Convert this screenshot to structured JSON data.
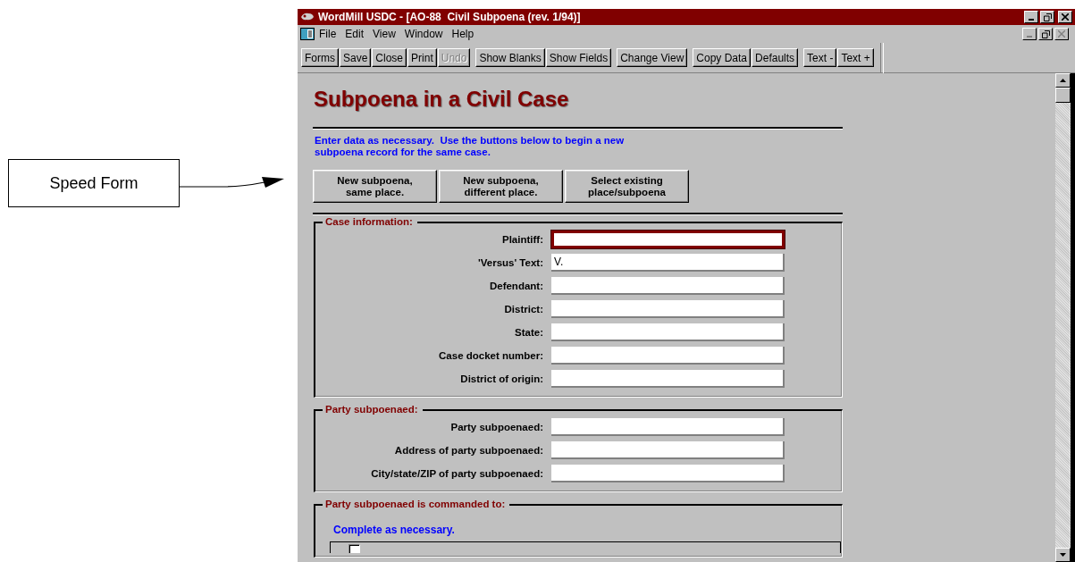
{
  "callout": {
    "label": "Speed Form"
  },
  "window": {
    "title": "WordMill USDC - [AO-88  Civil Subpoena (rev. 1/94)]"
  },
  "menu": [
    "File",
    "Edit",
    "View",
    "Window",
    "Help"
  ],
  "toolbar_groups": [
    [
      {
        "label": "Forms",
        "disabled": false
      },
      {
        "label": "Save",
        "disabled": false
      },
      {
        "label": "Close",
        "disabled": false
      },
      {
        "label": "Print",
        "disabled": false
      },
      {
        "label": "Undo",
        "disabled": true
      }
    ],
    [
      {
        "label": "Show Blanks",
        "disabled": false
      },
      {
        "label": "Show Fields",
        "disabled": false
      }
    ],
    [
      {
        "label": "Change View",
        "disabled": false
      }
    ],
    [
      {
        "label": "Copy Data",
        "disabled": false
      },
      {
        "label": "Defaults",
        "disabled": false
      }
    ],
    [
      {
        "label": "Text -",
        "disabled": false
      },
      {
        "label": "Text +",
        "disabled": false
      }
    ]
  ],
  "form": {
    "title": "Subpoena in a Civil Case",
    "instructions": [
      "Enter data as necessary.  Use the buttons below to begin a new",
      "subpoena record for the same case."
    ],
    "buttons": [
      {
        "lines": [
          "New subpoena,",
          "same place."
        ]
      },
      {
        "lines": [
          "New subpoena,",
          "different place."
        ]
      },
      {
        "lines": [
          "Select existing",
          "place/subpoena"
        ]
      }
    ],
    "groups": [
      {
        "title": "Case information:",
        "fields": [
          {
            "label": "Plaintiff:",
            "focused": true
          },
          {
            "label": "'Versus' Text:",
            "value": "V.",
            "focused": false
          },
          {
            "label": "Defendant:",
            "focused": false
          },
          {
            "label": "District:",
            "focused": false
          },
          {
            "label": "State:",
            "focused": false
          },
          {
            "label": "Case docket number:",
            "focused": false
          },
          {
            "label": "District of origin:",
            "focused": false
          }
        ]
      },
      {
        "title": "Party subpoenaed:",
        "fields": [
          {
            "label": "Party subpoenaed:",
            "focused": false
          },
          {
            "label": "Address of party subpoenaed:",
            "focused": false
          },
          {
            "label": "City/state/ZIP of party subpoenaed:",
            "focused": false
          }
        ]
      },
      {
        "title": "Party subpoenaed is commanded to:",
        "note": "Complete as necessary.",
        "options": [
          {
            "checked": false
          }
        ]
      }
    ]
  }
}
